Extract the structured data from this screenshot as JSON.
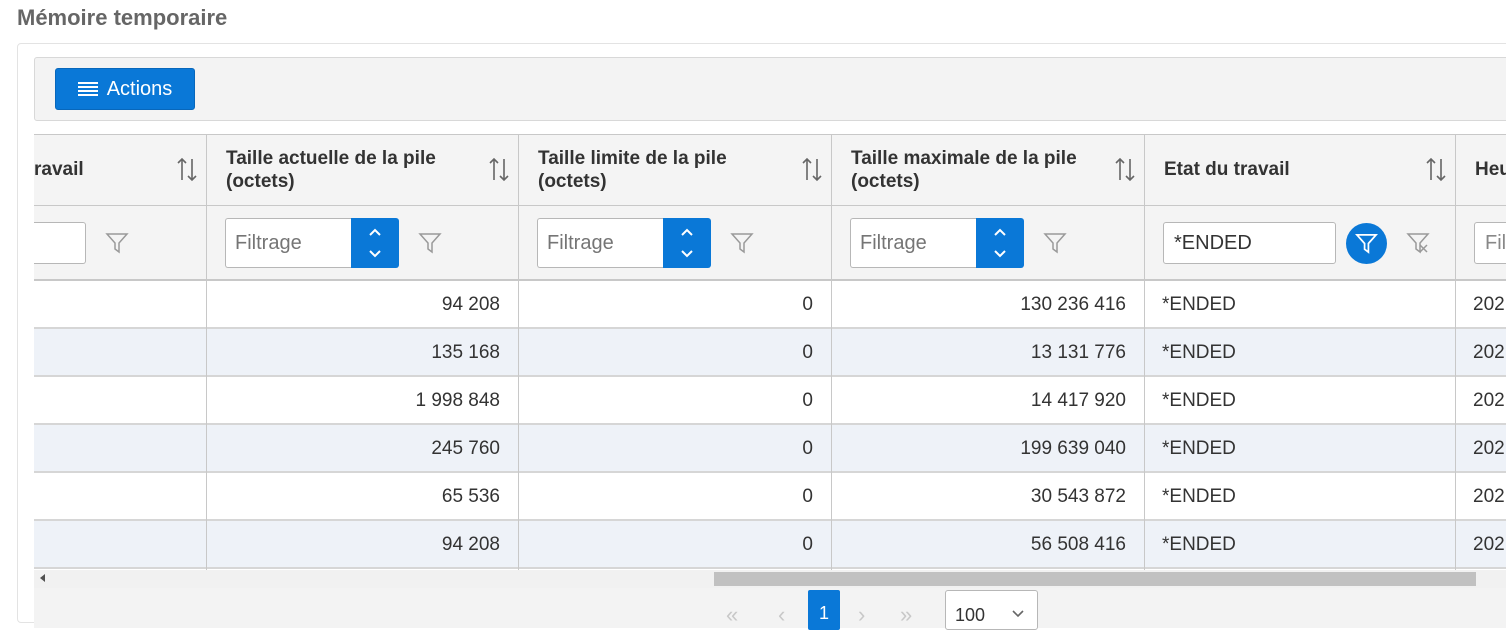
{
  "page": {
    "title": "Mémoire temporaire"
  },
  "toolbar": {
    "actions_label": "Actions"
  },
  "columns": [
    {
      "header": "ravail",
      "filter_placeholder": ""
    },
    {
      "header": "Taille actuelle de la pile (octets)",
      "filter_placeholder": "Filtrage"
    },
    {
      "header": "Taille limite de la pile (octets)",
      "filter_placeholder": "Filtrage"
    },
    {
      "header": "Taille maximale de la pile (octets)",
      "filter_placeholder": "Filtrage"
    },
    {
      "header": "Etat du travail",
      "filter_value": "*ENDED"
    },
    {
      "header": "Heu",
      "filter_placeholder": "Fil"
    }
  ],
  "rows": [
    {
      "current": "94 208",
      "limit": "0",
      "max": "130 236 416",
      "state": "*ENDED",
      "next": "202"
    },
    {
      "current": "135 168",
      "limit": "0",
      "max": "13 131 776",
      "state": "*ENDED",
      "next": "202"
    },
    {
      "current": "1 998 848",
      "limit": "0",
      "max": "14 417 920",
      "state": "*ENDED",
      "next": "202"
    },
    {
      "current": "245 760",
      "limit": "0",
      "max": "199 639 040",
      "state": "*ENDED",
      "next": "202"
    },
    {
      "current": "65 536",
      "limit": "0",
      "max": "30 543 872",
      "state": "*ENDED",
      "next": "202"
    },
    {
      "current": "94 208",
      "limit": "0",
      "max": "56 508 416",
      "state": "*ENDED",
      "next": "202"
    }
  ],
  "pager": {
    "current_page": "1",
    "page_size": "100"
  },
  "icons": {
    "menu": "hamburger-icon",
    "sort": "sort-arrows-icon",
    "filter": "funnel-icon",
    "filter_clear": "funnel-clear-icon",
    "spinner": "chevron-up-down-icon"
  },
  "colors": {
    "accent": "#0a78d7",
    "header_bg": "#f4f4f4",
    "alt_row": "#eef2f8"
  }
}
